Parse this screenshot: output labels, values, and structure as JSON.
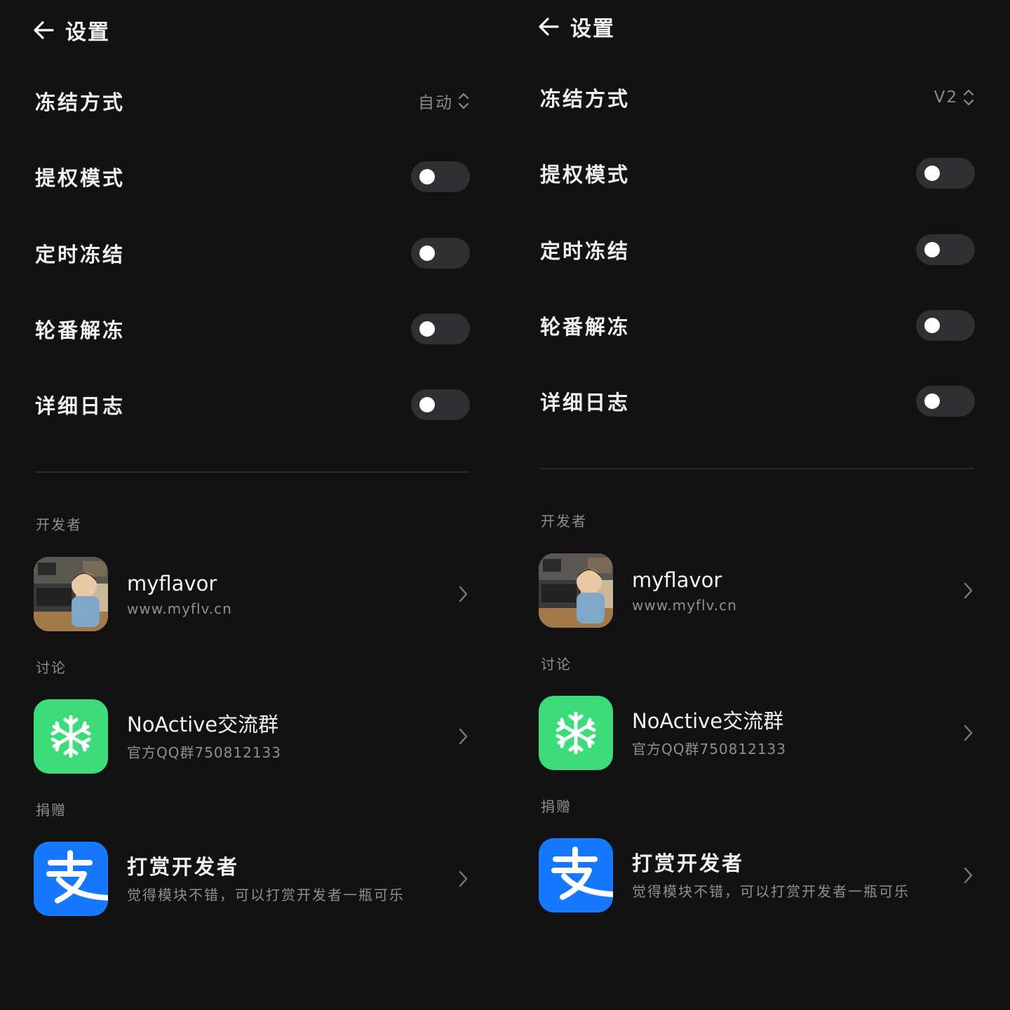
{
  "screens": [
    {
      "header": {
        "title": "设置",
        "back_icon": "arrow-left-icon"
      },
      "freeze_mode": {
        "label": "冻结方式",
        "value": "自动"
      },
      "toggles": [
        {
          "label": "提权模式",
          "on": false
        },
        {
          "label": "定时冻结",
          "on": false
        },
        {
          "label": "轮番解冻",
          "on": false
        },
        {
          "label": "详细日志",
          "on": false
        }
      ],
      "sections": {
        "developer": {
          "title": "开发者",
          "item": {
            "title": "myflavor",
            "subtitle": "www.myflv.cn",
            "icon": "developer-avatar-icon"
          }
        },
        "discussion": {
          "title": "讨论",
          "item": {
            "title": "NoActive交流群",
            "subtitle": "官方QQ群750812133",
            "icon": "snowflake-icon"
          }
        },
        "donate": {
          "title": "捐赠",
          "item": {
            "title": "打赏开发者",
            "subtitle": "觉得模块不错，可以打赏开发者一瓶可乐",
            "icon": "alipay-icon"
          }
        }
      }
    },
    {
      "header": {
        "title": "设置",
        "back_icon": "arrow-left-icon"
      },
      "freeze_mode": {
        "label": "冻结方式",
        "value": "V2"
      },
      "toggles": [
        {
          "label": "提权模式",
          "on": false
        },
        {
          "label": "定时冻结",
          "on": false
        },
        {
          "label": "轮番解冻",
          "on": false
        },
        {
          "label": "详细日志",
          "on": false
        }
      ],
      "sections": {
        "developer": {
          "title": "开发者",
          "item": {
            "title": "myflavor",
            "subtitle": "www.myflv.cn",
            "icon": "developer-avatar-icon"
          }
        },
        "discussion": {
          "title": "讨论",
          "item": {
            "title": "NoActive交流群",
            "subtitle": "官方QQ群750812133",
            "icon": "snowflake-icon"
          }
        },
        "donate": {
          "title": "捐赠",
          "item": {
            "title": "打赏开发者",
            "subtitle": "觉得模块不错，可以打赏开发者一瓶可乐",
            "icon": "alipay-icon"
          }
        }
      }
    }
  ],
  "colors": {
    "background": "#121212",
    "switch_track": "#303033",
    "green_icon": "#3ddc7a",
    "alipay_blue": "#1677ff"
  }
}
